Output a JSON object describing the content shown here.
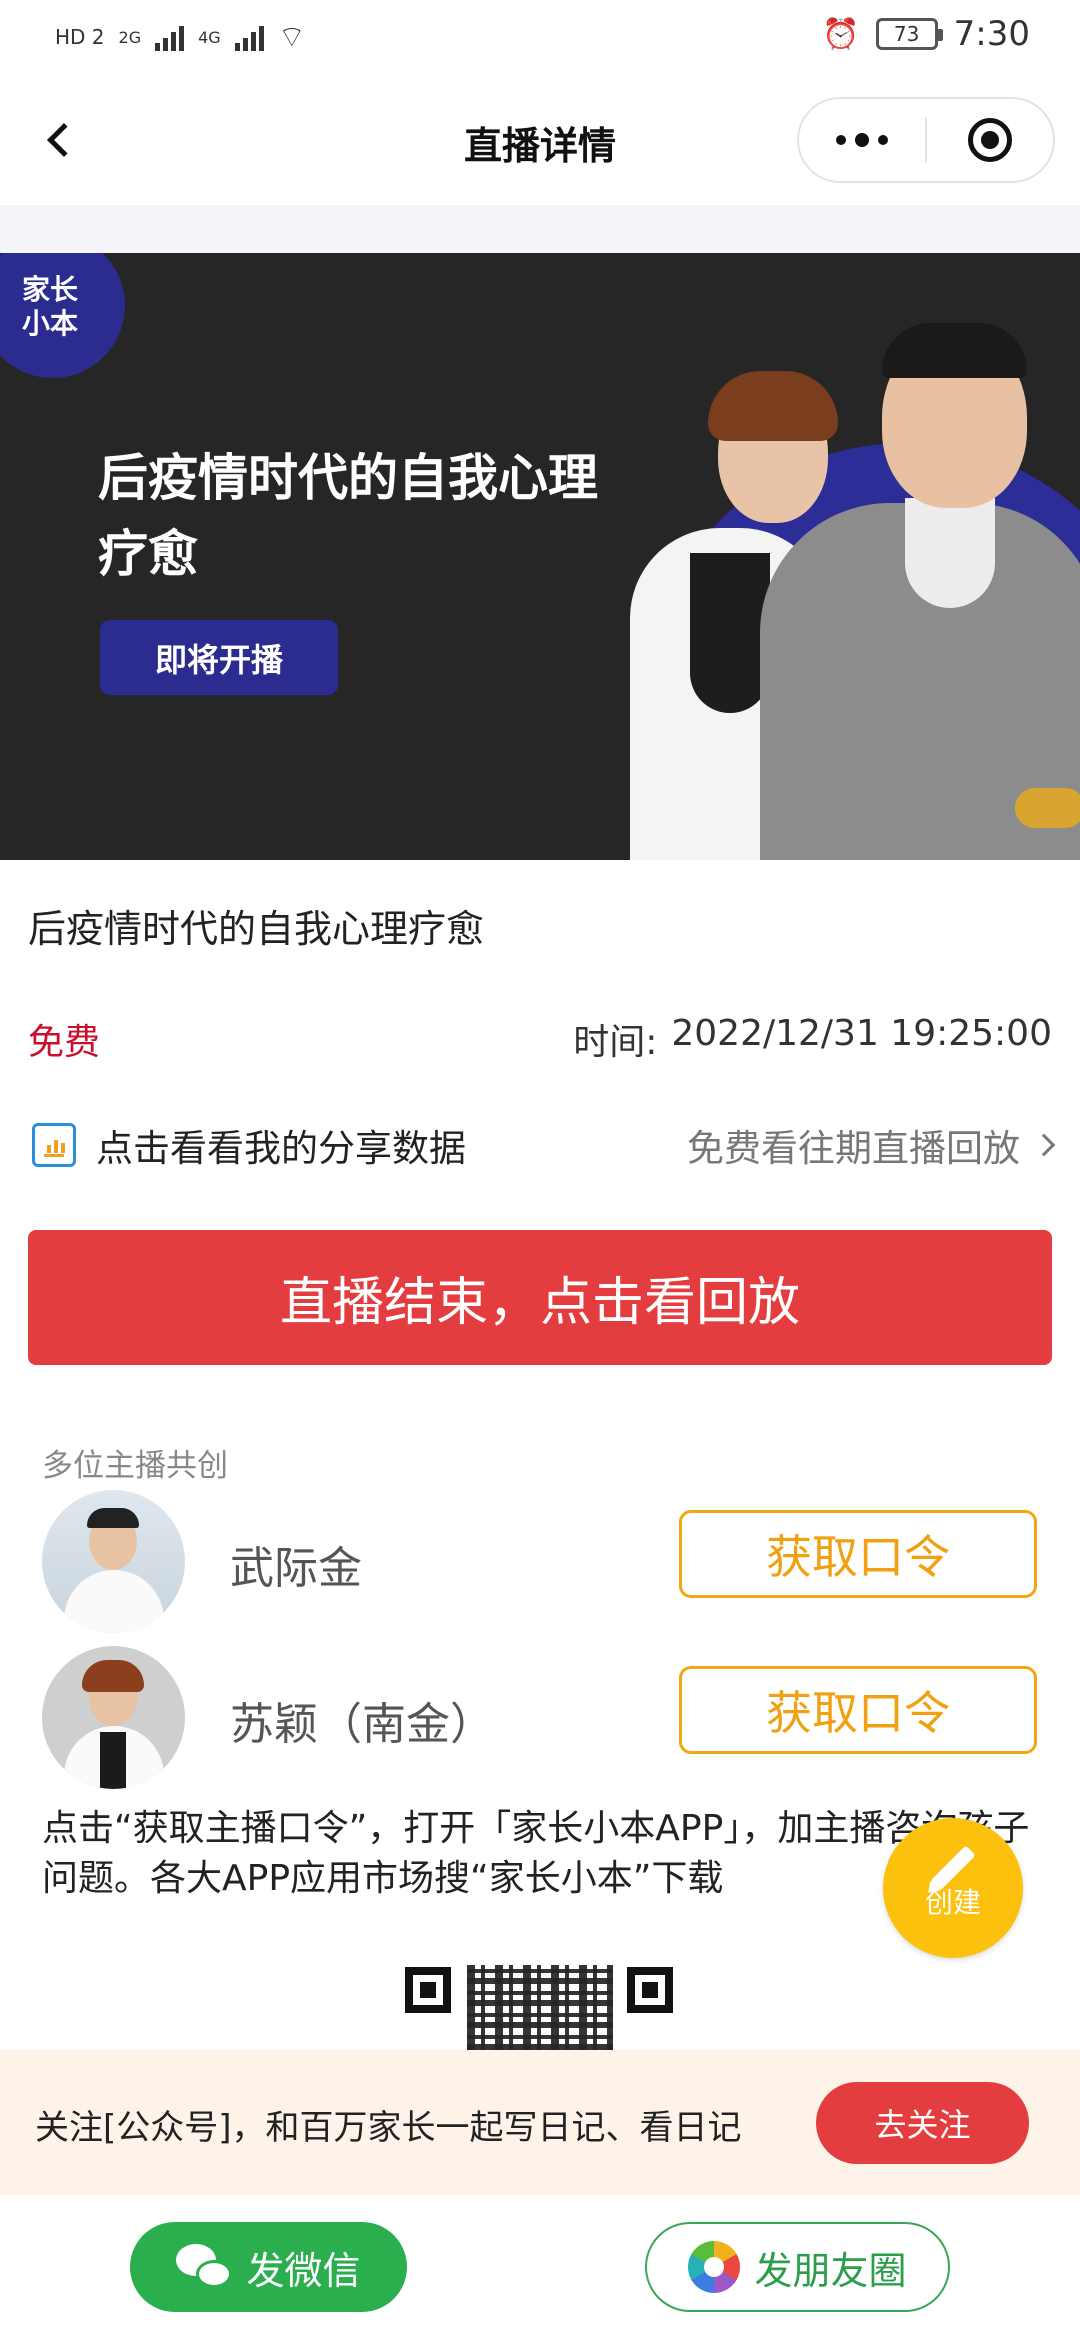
{
  "status_bar": {
    "hd": "HD 2",
    "net1": "2G",
    "net2": "4G",
    "battery": "73",
    "time": "7:30"
  },
  "nav": {
    "title": "直播详情"
  },
  "banner": {
    "logo": "家长\n小本",
    "title": "后疫情时代的自我心理疗愈",
    "badge": "即将开播"
  },
  "live": {
    "title": "后疫情时代的自我心理疗愈",
    "price": "免费",
    "time_label": "时间:",
    "time_value": "2022/12/31 19:25:00",
    "share_link": "点击看看我的分享数据",
    "replay_link": "免费看往期直播回放",
    "replay_button": "直播结束，点击看回放"
  },
  "hosts": {
    "label": "多位主播共创",
    "items": [
      {
        "name": "武际金",
        "button": "获取口令"
      },
      {
        "name": "苏颖（南金）",
        "button": "获取口令"
      }
    ]
  },
  "instruction": "点击“获取主播口令”，打开「家长小本APP」，加主播咨询孩子问题。各大APP应用市场搜“家长小本”下载",
  "create_button": "创建",
  "follow": {
    "text": "关注[公众号]，和百万家长一起写日记、看日记",
    "button": "去关注"
  },
  "bottom": {
    "wechat": "发微信",
    "moments": "发朋友圈"
  },
  "colors": {
    "accent_red": "#e43d3f",
    "price_red": "#c8102e",
    "orange": "#f3a613",
    "green": "#2aae4e",
    "brand_blue": "#2c2b8f",
    "create_yellow": "#fcc10d"
  }
}
